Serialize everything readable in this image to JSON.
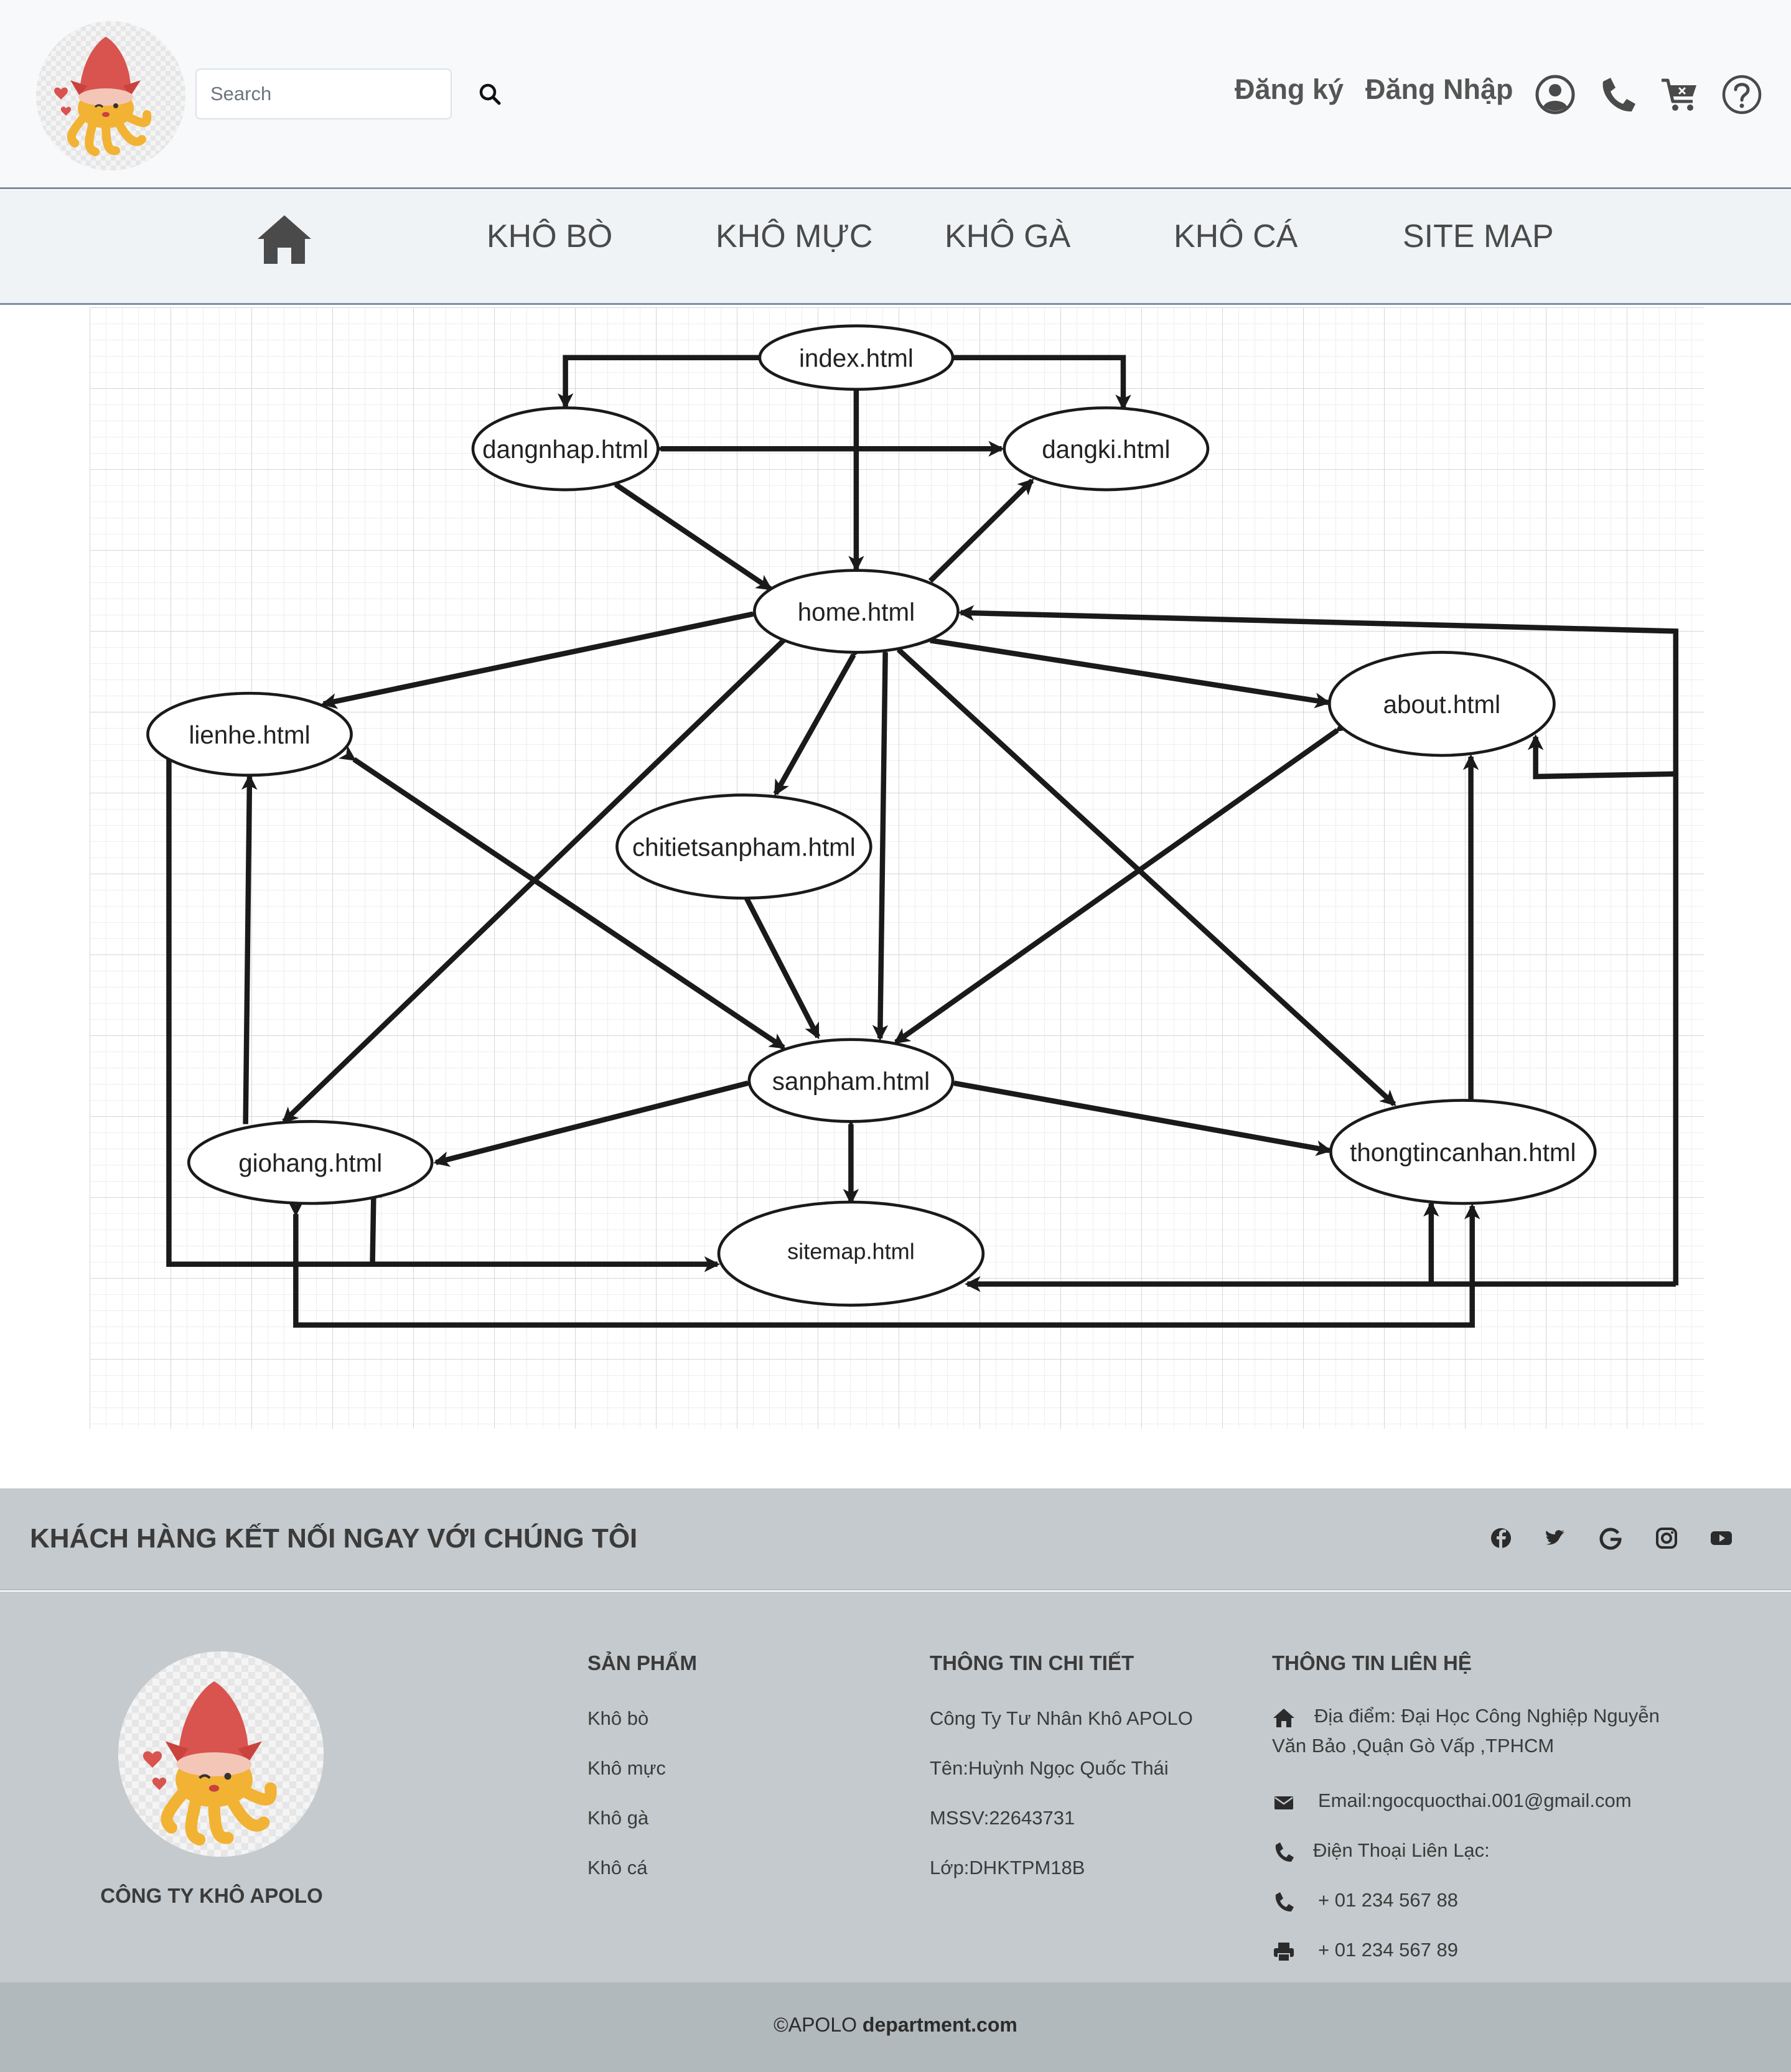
{
  "header": {
    "search_placeholder": "Search",
    "register_label": "Đăng ký",
    "login_label": "Đăng Nhập"
  },
  "nav": {
    "items": [
      "KHÔ BÒ",
      "KHÔ MỰC",
      "KHÔ GÀ",
      "KHÔ CÁ",
      "SITE MAP"
    ]
  },
  "sitemap": {
    "nodes": {
      "index": "index.html",
      "dangnhap": "dangnhap.html",
      "dangki": "dangki.html",
      "home": "home.html",
      "lienhe": "lienhe.html",
      "about": "about.html",
      "chitietsanpham": "chitietsanpham.html",
      "sanpham": "sanpham.html",
      "giohang": "giohang.html",
      "thongtincanhan": "thongtincanhan.html",
      "sitemap": "sitemap.html"
    }
  },
  "footer": {
    "connect_title": "KHÁCH HÀNG KẾT NỐI NGAY VỚI CHÚNG TÔI",
    "social_icons": [
      "facebook-icon",
      "twitter-icon",
      "google-icon",
      "instagram-icon",
      "youtube-icon"
    ],
    "company_name": "CÔNG TY KHÔ APOLO",
    "products": {
      "title": "SẢN PHẨM",
      "items": [
        "Khô bò",
        "Khô mực",
        "Khô gà",
        "Khô cá"
      ]
    },
    "details": {
      "title": "THÔNG TIN CHI TIẾT",
      "items": [
        "Công Ty Tư Nhân Khô APOLO",
        "Tên:Huỳnh Ngọc Quốc Thái",
        "MSSV:22643731",
        "Lớp:DHKTPM18B"
      ]
    },
    "contact": {
      "title": "THÔNG TIN LIÊN HỆ",
      "address": "Địa điểm: Đại Học Công Nghiệp Nguyễn Văn Bảo ,Quận Gò Vấp ,TPHCM",
      "email": "Email:ngocquocthai.001@gmail.com",
      "phone_label": "Điện Thoại Liên Lạc:",
      "phone": "+ 01 234 567 88",
      "fax": "+ 01 234 567 89"
    },
    "copyright_prefix": "©APOLO",
    "copyright_bold": "department.com"
  },
  "colors": {
    "header_bg": "#f8f9fa",
    "nav_bg": "#f0f3f5",
    "footer_bg": "#c4cacd",
    "bottom_bg": "#b2b9bd",
    "squid_red": "#d9534f",
    "octopus_yellow": "#f2b233"
  }
}
